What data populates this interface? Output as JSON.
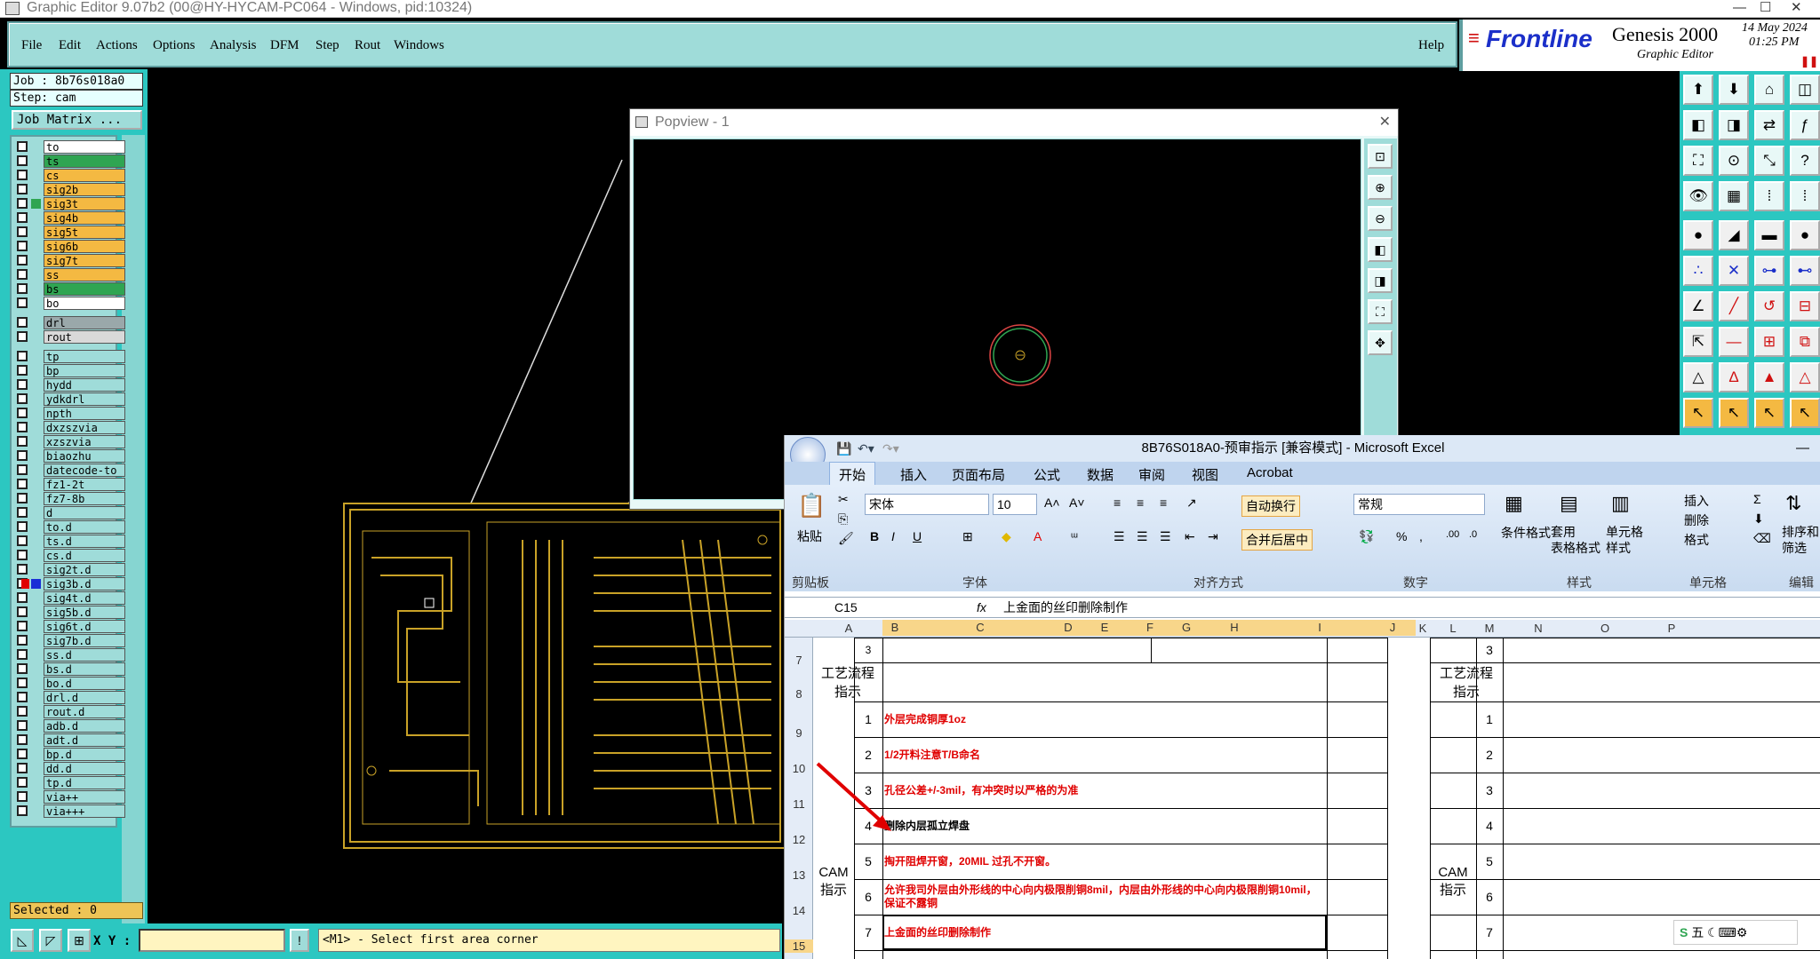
{
  "window": {
    "title": "Graphic Editor 9.07b2 (00@HY-HYCAM-PC064 - Windows, pid:10324)",
    "minimize": "—",
    "maximize": "☐",
    "close": "✕"
  },
  "menu": {
    "items": [
      "File",
      "Edit",
      "Actions",
      "Options",
      "Analysis",
      "DFM",
      "Step",
      "Rout",
      "Windows"
    ],
    "help": "Help"
  },
  "branding": {
    "logo": "Frontline",
    "product": "Genesis 2000",
    "subtitle": "Graphic Editor",
    "date": "14 May 2024",
    "time": "01:25 PM"
  },
  "job": {
    "job_label": "Job : 8b76s018a0",
    "step_label": "Step: cam",
    "matrix_button": "Job Matrix ..."
  },
  "layers": [
    {
      "name": "to",
      "color": "#ffffff"
    },
    {
      "name": "ts",
      "color": "#2fa552"
    },
    {
      "name": "cs",
      "color": "#f4b942"
    },
    {
      "name": "sig2b",
      "color": "#f4b942"
    },
    {
      "name": "sig3t",
      "color": "#f4b942",
      "marker": "#2fa552"
    },
    {
      "name": "sig4b",
      "color": "#f4b942"
    },
    {
      "name": "sig5t",
      "color": "#f4b942"
    },
    {
      "name": "sig6b",
      "color": "#f4b942"
    },
    {
      "name": "sig7t",
      "color": "#f4b942"
    },
    {
      "name": "ss",
      "color": "#f4b942"
    },
    {
      "name": "bs",
      "color": "#2fa552"
    },
    {
      "name": "bo",
      "color": "#ffffff"
    },
    {
      "name": "drl",
      "color": "#9aa8aa",
      "gap": true
    },
    {
      "name": "rout",
      "color": "#d9d9d9"
    },
    {
      "name": "tp",
      "color": "#9fdcd9",
      "gap": true
    },
    {
      "name": "bp",
      "color": "#9fdcd9"
    },
    {
      "name": "hydd",
      "color": "#9fdcd9"
    },
    {
      "name": "ydkdrl",
      "color": "#9fdcd9"
    },
    {
      "name": "npth",
      "color": "#9fdcd9"
    },
    {
      "name": "dxzszvia",
      "color": "#9fdcd9"
    },
    {
      "name": "xzszvia",
      "color": "#9fdcd9"
    },
    {
      "name": "biaozhu",
      "color": "#9fdcd9"
    },
    {
      "name": "datecode-to",
      "color": "#9fdcd9"
    },
    {
      "name": "fz1-2t",
      "color": "#9fdcd9"
    },
    {
      "name": "fz7-8b",
      "color": "#9fdcd9"
    },
    {
      "name": "d",
      "color": "#9fdcd9"
    },
    {
      "name": "to.d",
      "color": "#9fdcd9"
    },
    {
      "name": "ts.d",
      "color": "#9fdcd9"
    },
    {
      "name": "cs.d",
      "color": "#9fdcd9"
    },
    {
      "name": "sig2t.d",
      "color": "#9fdcd9"
    },
    {
      "name": "sig3b.d",
      "color": "#9fdcd9",
      "marker": "#1a2fd6",
      "marker2": "#e00000"
    },
    {
      "name": "sig4t.d",
      "color": "#9fdcd9"
    },
    {
      "name": "sig5b.d",
      "color": "#9fdcd9"
    },
    {
      "name": "sig6t.d",
      "color": "#9fdcd9"
    },
    {
      "name": "sig7b.d",
      "color": "#9fdcd9"
    },
    {
      "name": "ss.d",
      "color": "#9fdcd9"
    },
    {
      "name": "bs.d",
      "color": "#9fdcd9"
    },
    {
      "name": "bo.d",
      "color": "#9fdcd9"
    },
    {
      "name": "drl.d",
      "color": "#9fdcd9"
    },
    {
      "name": "rout.d",
      "color": "#9fdcd9"
    },
    {
      "name": "adb.d",
      "color": "#9fdcd9"
    },
    {
      "name": "adt.d",
      "color": "#9fdcd9"
    },
    {
      "name": "bp.d",
      "color": "#9fdcd9"
    },
    {
      "name": "dd.d",
      "color": "#9fdcd9"
    },
    {
      "name": "tp.d",
      "color": "#9fdcd9"
    },
    {
      "name": "via++",
      "color": "#9fdcd9"
    },
    {
      "name": "via+++",
      "color": "#9fdcd9"
    }
  ],
  "status": {
    "selected": "Selected : 0",
    "xy_label": "X Y :",
    "message": "<M1> - Select first area corner"
  },
  "popview": {
    "title": "Popview - 1"
  },
  "excel": {
    "title": "8B76S018A0-预审指示  [兼容模式] - Microsoft Excel",
    "tabs": [
      "开始",
      "插入",
      "页面布局",
      "公式",
      "数据",
      "审阅",
      "视图",
      "Acrobat"
    ],
    "ribbon": {
      "paste": "粘贴",
      "font_name": "宋体",
      "font_size": "10",
      "wrap": "自动换行",
      "merge": "合并后居中",
      "number_format": "常规",
      "cond_format": "条件格式",
      "table_format": "套用\n表格格式",
      "cell_style": "单元格\n样式",
      "insert": "插入",
      "delete": "删除",
      "format": "格式",
      "sort": "排序和\n筛选",
      "groups": [
        "剪贴板",
        "字体",
        "对齐方式",
        "数字",
        "样式",
        "单元格",
        "编辑"
      ]
    },
    "namebox": "C15",
    "fx": "fx",
    "formula": "上金面的丝印删除制作",
    "columns": [
      "A",
      "B",
      "C",
      "D",
      "E",
      "F",
      "G",
      "H",
      "I",
      "J",
      "K",
      "L",
      "M",
      "N",
      "O",
      "P"
    ],
    "rows": [
      "7",
      "8",
      "9",
      "10",
      "11",
      "12",
      "13",
      "14",
      "15"
    ],
    "section_flow": "工艺流程\n指示",
    "section_cam": "CAM\n指示",
    "row7_num": "3",
    "items": [
      {
        "no": "1",
        "text": "外层完成铜厚1oz",
        "red": true
      },
      {
        "no": "2",
        "text": "1/2开料注意T/B命名",
        "red": true
      },
      {
        "no": "3",
        "text": "孔径公差+/-3mil，有冲突时以严格的为准",
        "red": true
      },
      {
        "no": "4",
        "text": "删除内层孤立焊盘",
        "red": false
      },
      {
        "no": "5",
        "text": "掏开阻焊开窗，20MIL 过孔不开窗。",
        "red": true
      },
      {
        "no": "6",
        "text": "允许我司外层由外形线的中心向内极限削铜8mil，内层由外形线的中心向内极限削铜10mil，保证不露铜",
        "red": true
      },
      {
        "no": "7",
        "text": "上金面的丝印删除制作",
        "red": true
      }
    ],
    "right_nums": [
      "3",
      "1",
      "2",
      "3",
      "4",
      "5",
      "6",
      "7"
    ],
    "ime": "五"
  }
}
